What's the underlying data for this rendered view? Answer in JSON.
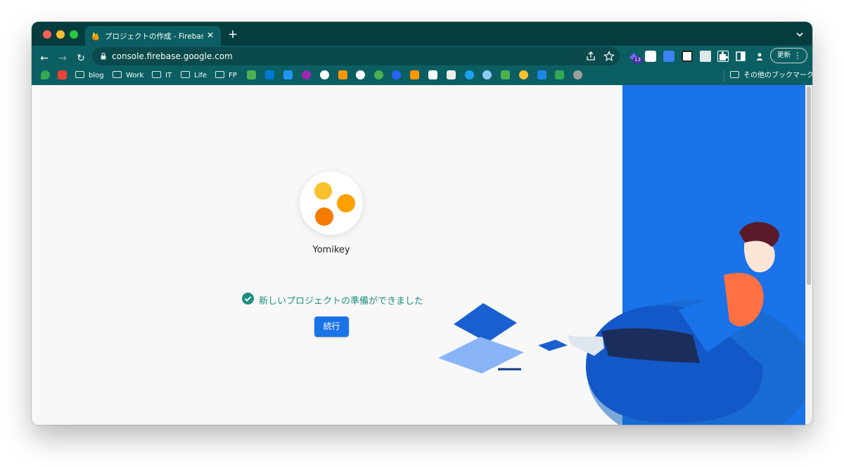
{
  "browser": {
    "tab_title": "プロジェクトの作成 - Firebase コンソール",
    "tab_favicon": "firebase-flame-icon",
    "url": "console.firebase.google.com",
    "update_label": "更新"
  },
  "bookmarks": {
    "items": [
      "blog",
      "Work",
      "IT",
      "Life",
      "FP"
    ],
    "other": "その他のブックマーク"
  },
  "extension_badge": "13",
  "page": {
    "project_name": "Yomikey",
    "ready_message": "新しいプロジェクトの準備ができました",
    "continue_label": "続行"
  },
  "colors": {
    "chrome_dark": "#053d3f",
    "chrome": "#0b5f62",
    "accent": "#1a73e8",
    "success": "#1e8e7e",
    "logo_yellow": "#fbc02d",
    "logo_orange": "#ffa000",
    "logo_dark_orange": "#f57c00"
  }
}
